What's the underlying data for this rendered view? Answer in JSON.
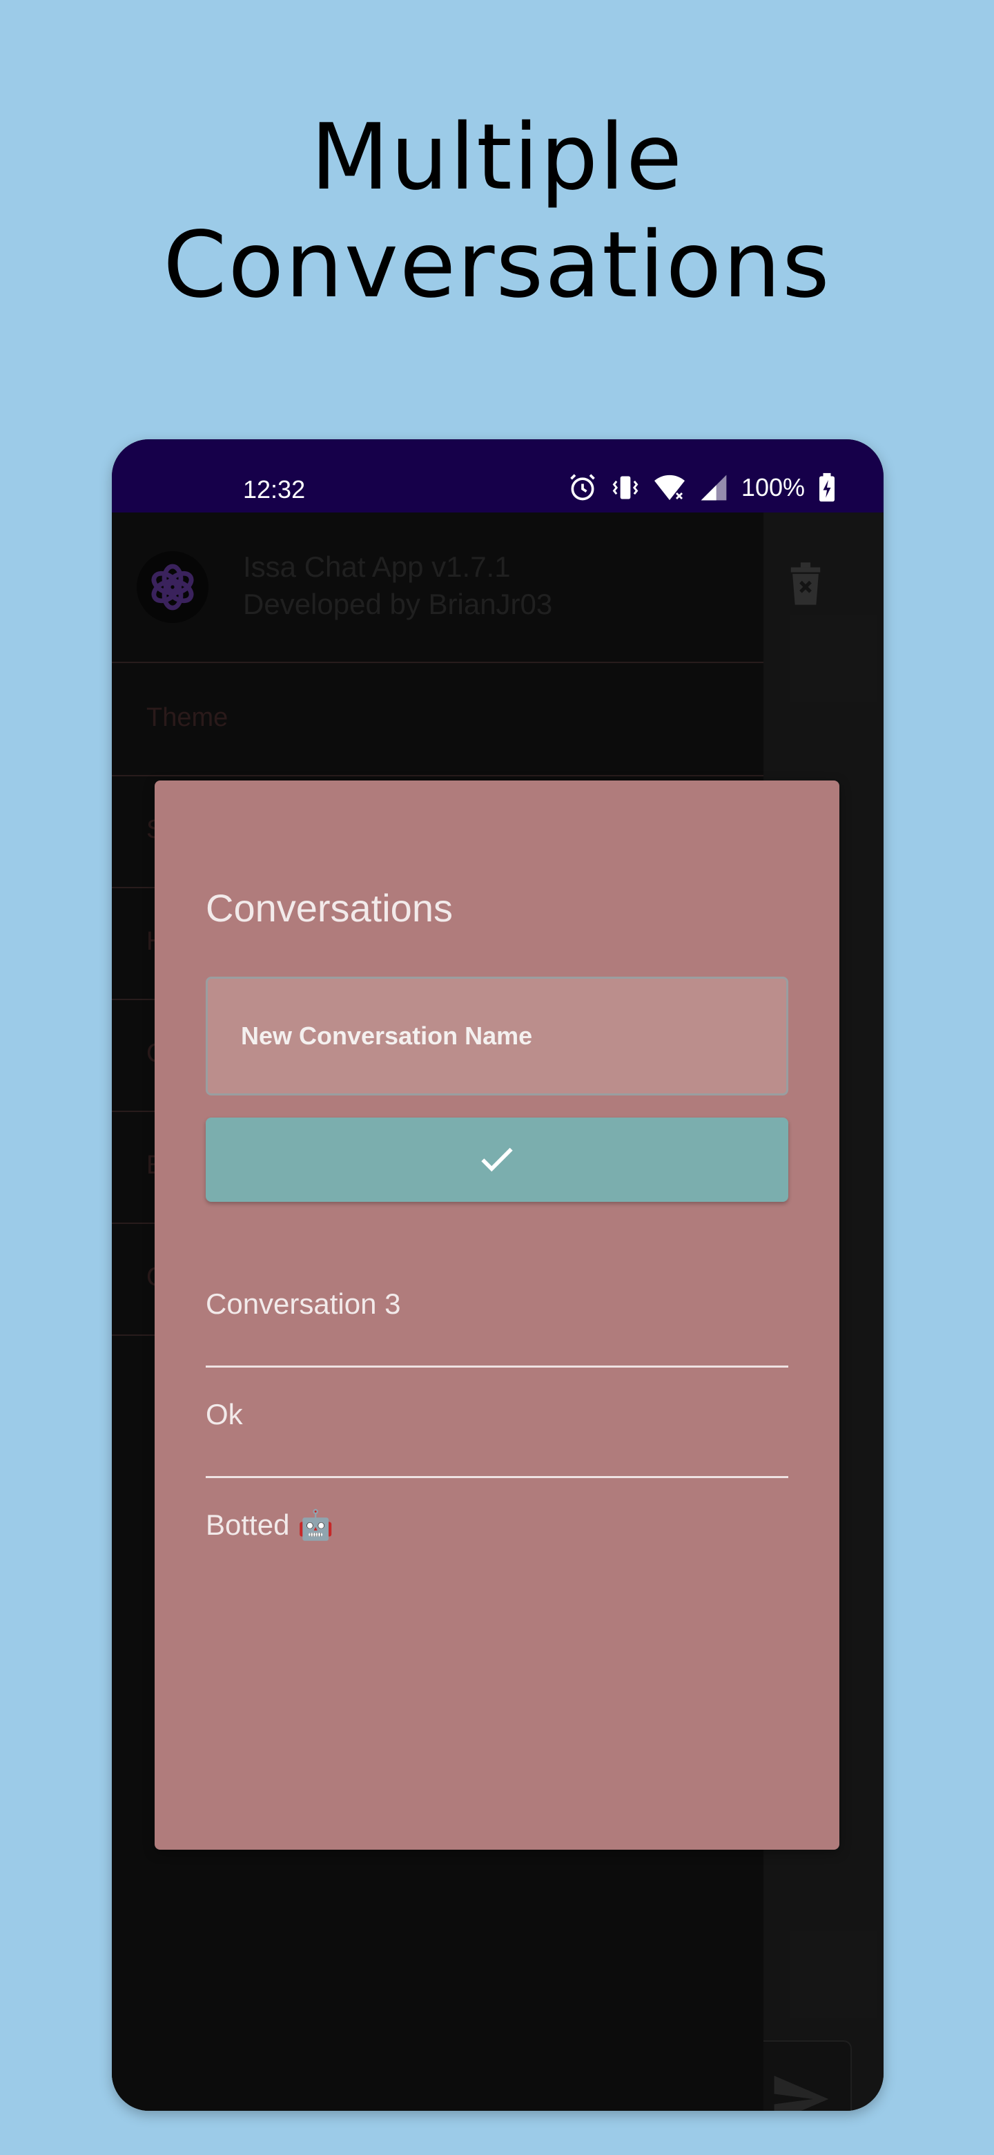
{
  "headline": {
    "line1": "Multiple",
    "line2": "Conversations"
  },
  "statusbar": {
    "time": "12:32",
    "battery": "100%"
  },
  "drawer": {
    "app_name": "Issa Chat App v1.7.1",
    "developer": "Developed by BrianJr03",
    "items": [
      {
        "label": "Theme"
      },
      {
        "label": "S"
      },
      {
        "label": "H"
      },
      {
        "label": "C"
      },
      {
        "label": "E"
      },
      {
        "label": "C"
      }
    ]
  },
  "dialog": {
    "title": "Conversations",
    "input_placeholder": "New Conversation Name",
    "conversations": [
      {
        "label": "Conversation 3"
      },
      {
        "label": "Ok"
      },
      {
        "label": "Botted 🤖"
      }
    ]
  },
  "colors": {
    "background": "#9ccbe8",
    "status_bar": "#16004a",
    "dialog": "#b07c7c",
    "confirm_button": "#7baeae"
  },
  "icons": [
    "alarm-icon",
    "vibrate-icon",
    "wifi-icon",
    "signal-icon",
    "battery-charging-icon",
    "app-logo-icon",
    "trash-icon",
    "send-icon",
    "check-icon"
  ]
}
